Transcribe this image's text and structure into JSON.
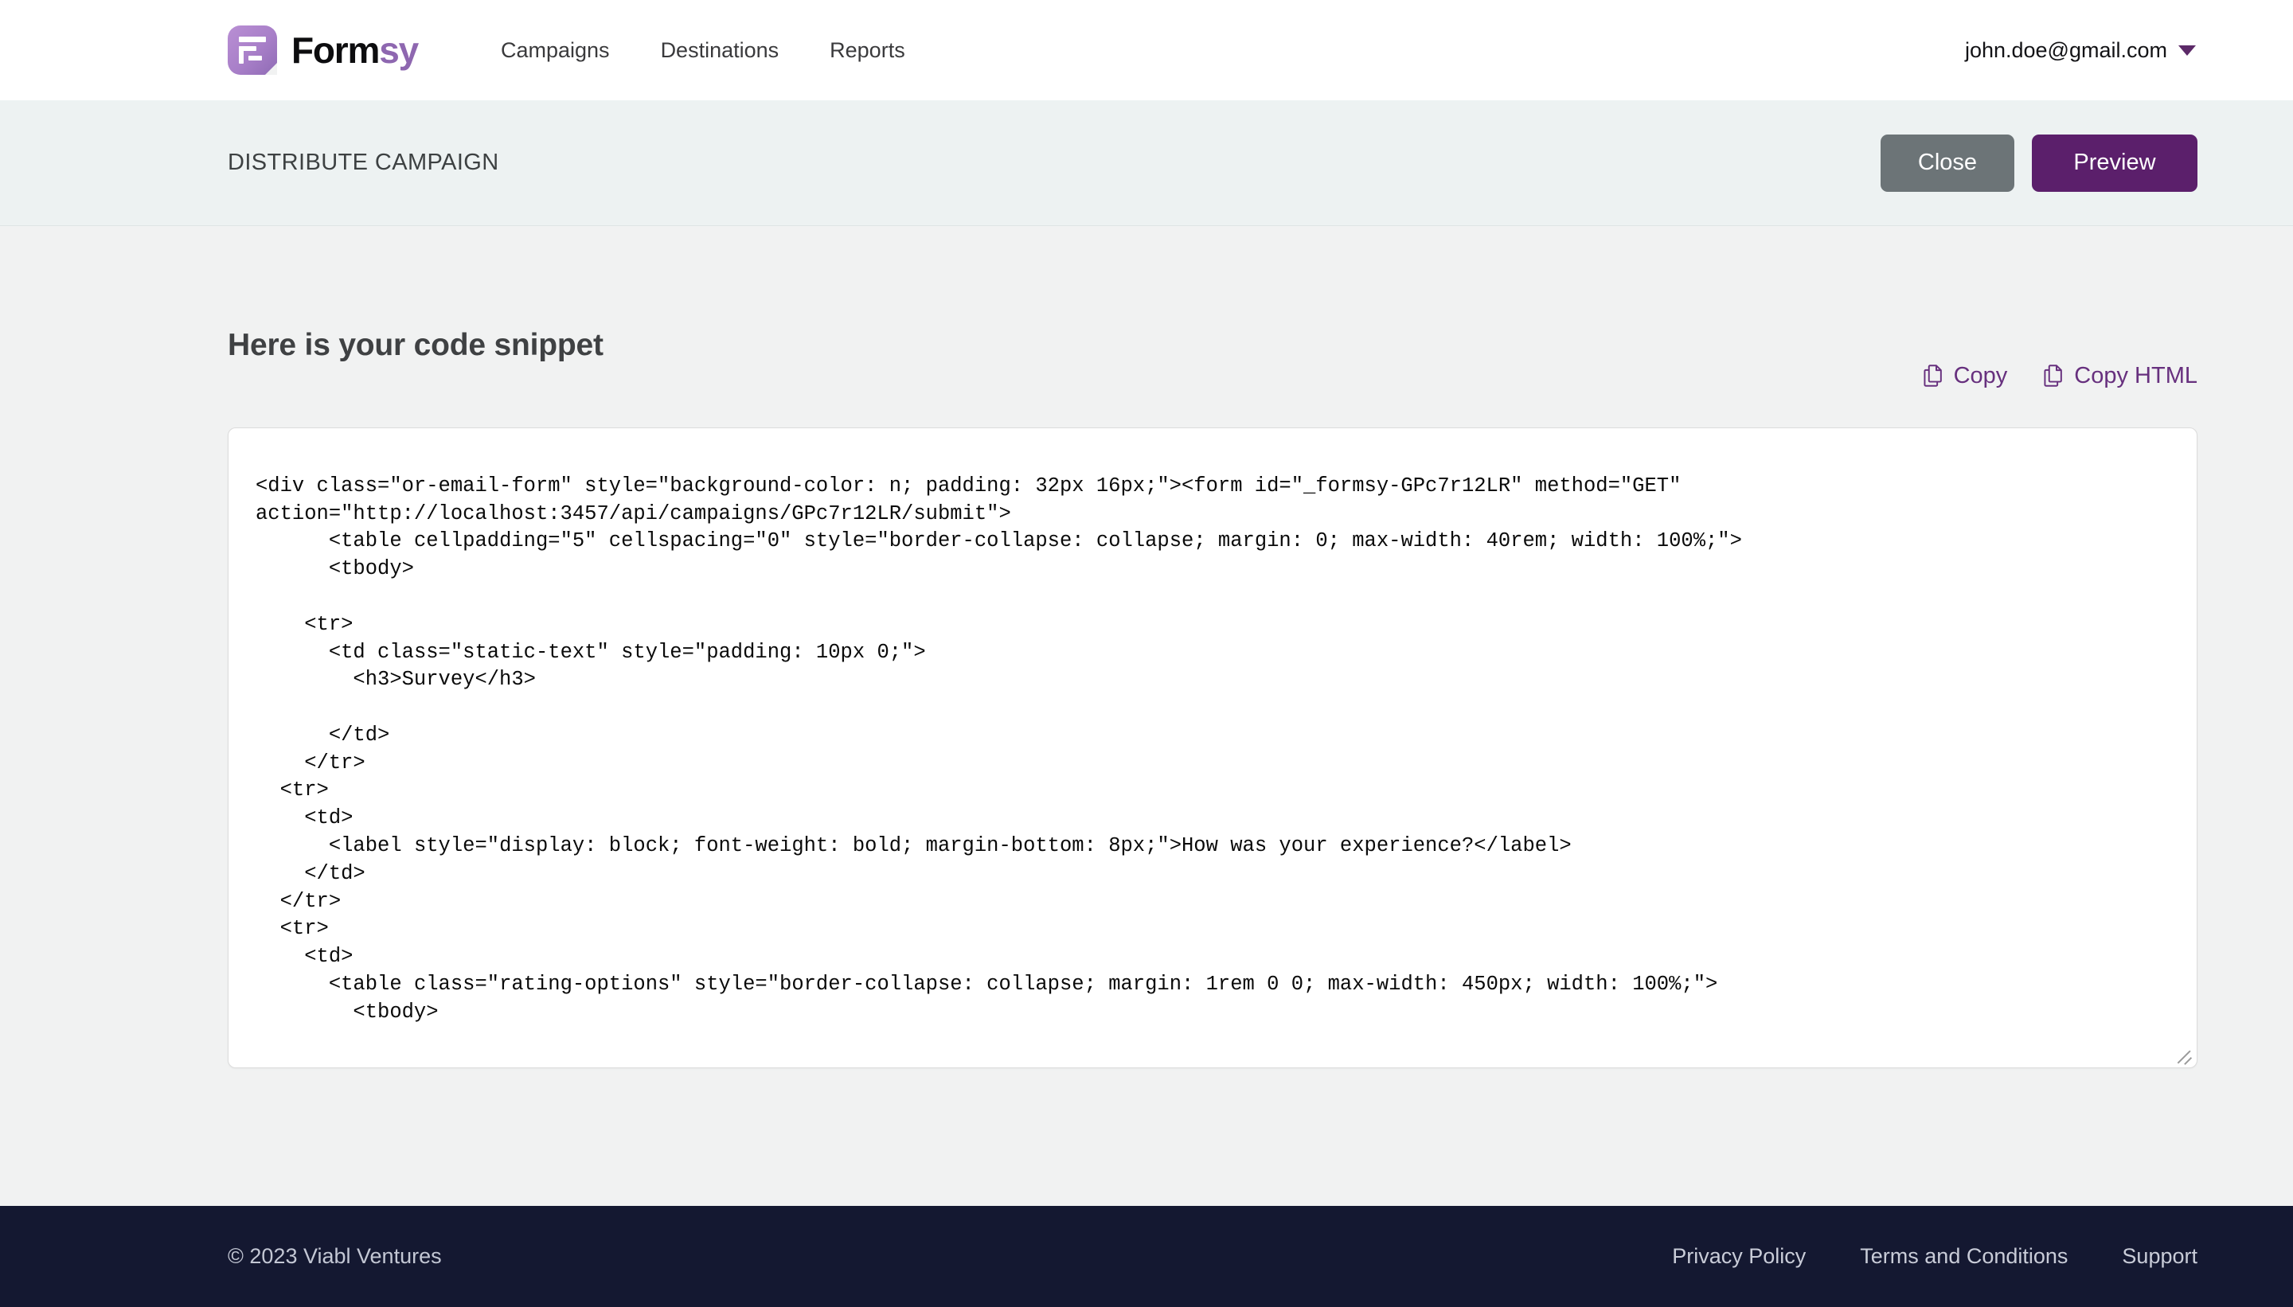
{
  "brand": {
    "name_dark": "Form",
    "name_accent": "sy",
    "logo_icon": "formsy-logo-icon",
    "accent_color": "#8e67b0"
  },
  "nav": {
    "links": [
      {
        "label": "Campaigns"
      },
      {
        "label": "Destinations"
      },
      {
        "label": "Reports"
      }
    ],
    "user_email": "john.doe@gmail.com",
    "caret_icon": "chevron-down-icon"
  },
  "subheader": {
    "title": "DISTRIBUTE CAMPAIGN",
    "close_label": "Close",
    "preview_label": "Preview",
    "close_color": "#6c7477",
    "preview_color": "#5b1f6b"
  },
  "main": {
    "snippet_title": "Here is your code snippet",
    "copy_label": "Copy",
    "copy_html_label": "Copy HTML",
    "copy_icon": "copy-icon",
    "link_color": "#67307e",
    "code": "<div class=\"or-email-form\" style=\"background-color: n; padding: 32px 16px;\"><form id=\"_formsy-GPc7r12LR\" method=\"GET\" action=\"http://localhost:3457/api/campaigns/GPc7r12LR/submit\">\n      <table cellpadding=\"5\" cellspacing=\"0\" style=\"border-collapse: collapse; margin: 0; max-width: 40rem; width: 100%;\">\n      <tbody>\n\n    <tr>\n      <td class=\"static-text\" style=\"padding: 10px 0;\">\n        <h3>Survey</h3>\n\n      </td>\n    </tr>\n  <tr>\n    <td>\n      <label style=\"display: block; font-weight: bold; margin-bottom: 8px;\">How was your experience?</label>\n    </td>\n  </tr>\n  <tr>\n    <td>\n      <table class=\"rating-options\" style=\"border-collapse: collapse; margin: 1rem 0 0; max-width: 450px; width: 100%;\">\n        <tbody>"
  },
  "footer": {
    "copyright": "© 2023 Viabl Ventures",
    "links": [
      {
        "label": "Privacy Policy"
      },
      {
        "label": "Terms and Conditions"
      },
      {
        "label": "Support"
      }
    ]
  }
}
